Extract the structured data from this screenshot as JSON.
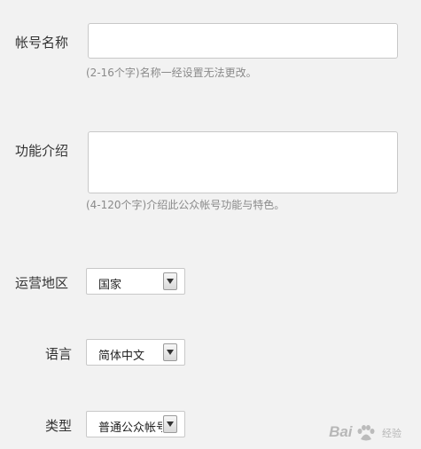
{
  "form": {
    "account_name": {
      "label": "帐号名称",
      "value": "",
      "hint": "(2-16个字)名称一经设置无法更改。"
    },
    "intro": {
      "label": "功能介绍",
      "value": "",
      "hint": "(4-120个字)介绍此公众帐号功能与特色。"
    },
    "region": {
      "label": "运营地区",
      "selected": "国家"
    },
    "language": {
      "label": "语言",
      "selected": "简体中文"
    },
    "type": {
      "label": "类型",
      "selected": "普通公众帐号"
    }
  },
  "watermark": {
    "text": "Bai",
    "text2": "经验"
  },
  "icons": [
    "dropdown-arrow-icon",
    "baidu-paw-icon"
  ],
  "colors": {
    "background": "#f2f2f2",
    "hint": "#8a8a8a",
    "border": "#c8c8c8"
  }
}
